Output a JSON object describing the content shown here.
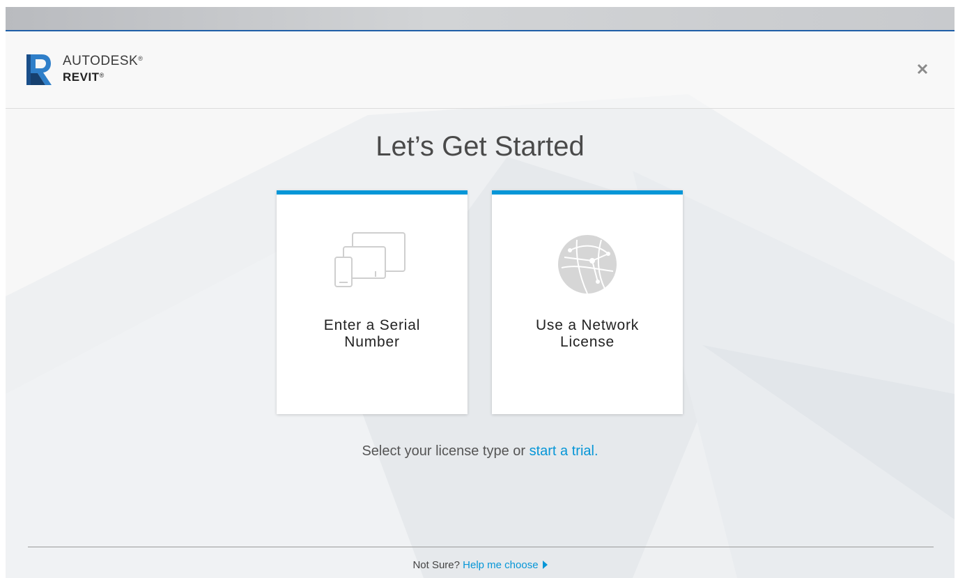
{
  "header": {
    "brand_top": "AUTODESK",
    "brand_bottom": "REVIT",
    "registered_mark": "®",
    "close_icon": "close-icon"
  },
  "main": {
    "title": "Let’s Get Started",
    "cards": [
      {
        "label_line1": "Enter a Serial",
        "label_line2": "Number",
        "icon": "devices-icon"
      },
      {
        "label_line1": "Use a Network",
        "label_line2": "License",
        "icon": "network-globe-icon"
      }
    ],
    "select_text": "Select your license type or ",
    "trial_link": "start a trial."
  },
  "footer": {
    "prefix": "Not Sure? ",
    "help_link": "Help me choose"
  },
  "colors": {
    "accent": "#0696d7",
    "titlebar_border": "#1f5fa8"
  }
}
